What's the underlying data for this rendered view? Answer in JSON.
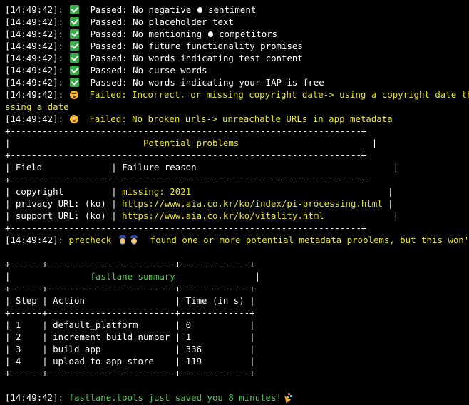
{
  "log_lines": [
    {
      "time": "[14:49:42]:",
      "status": "Passed:",
      "message": "No negative ",
      "icon": "apple-icon",
      "message_after": " sentiment"
    },
    {
      "time": "[14:49:42]:",
      "status": "Passed:",
      "message": "No placeholder text"
    },
    {
      "time": "[14:49:42]:",
      "status": "Passed:",
      "message": "No mentioning ",
      "icon": "apple-icon",
      "message_after": " competitors"
    },
    {
      "time": "[14:49:42]:",
      "status": "Passed:",
      "message": "No future functionality promises"
    },
    {
      "time": "[14:49:42]:",
      "status": "Passed:",
      "message": "No words indicating test content"
    },
    {
      "time": "[14:49:42]:",
      "status": "Passed:",
      "message": "No curse words"
    },
    {
      "time": "[14:49:42]:",
      "status": "Passed:",
      "message": "No words indicating your IAP is free"
    },
    {
      "time": "[14:49:42]:",
      "status": "Failed:",
      "message": "Incorrect, or missing copyright date-> using a copyright date that is"
    },
    {
      "continuation": "ssing a date"
    },
    {
      "time": "[14:49:42]:",
      "status": "Failed:",
      "message": "No broken urls-> unreachable URLs in app metadata"
    }
  ],
  "problems_table": {
    "border": "+------------------------------------------------------------------+",
    "title": "Potential problems",
    "col1_header": "Field",
    "col2_header": "Failure reason",
    "rows": [
      {
        "field": "copyright",
        "reason": "missing: 2021"
      },
      {
        "field": "privacy URL: (ko)",
        "reason": "https://www.aia.co.kr/ko/index/pi-processing.html"
      },
      {
        "field": "support URL: (ko)",
        "reason": "https://www.aia.co.kr/ko/vitality.html"
      }
    ]
  },
  "precheck_line": {
    "time": "[14:49:42]:",
    "label": "precheck",
    "message": "found one or more potential metadata problems, but this won't pre"
  },
  "summary_table": {
    "title": "fastlane summary",
    "headers": [
      "Step",
      "Action",
      "Time (in s)"
    ],
    "rows": [
      {
        "step": "1",
        "action": "default_platform",
        "time": "0"
      },
      {
        "step": "2",
        "action": "increment_build_number",
        "time": "1"
      },
      {
        "step": "3",
        "action": "build_app",
        "time": "336"
      },
      {
        "step": "4",
        "action": "upload_to_app_store",
        "time": "119"
      }
    ]
  },
  "final_line": {
    "time": "[14:49:42]:",
    "message": "fastlane.tools just saved you 8 minutes!"
  },
  "colors": {
    "background": "#000000",
    "text": "#ffffff",
    "warning_yellow": "#e6e23a",
    "success_green": "#4fd24f"
  }
}
